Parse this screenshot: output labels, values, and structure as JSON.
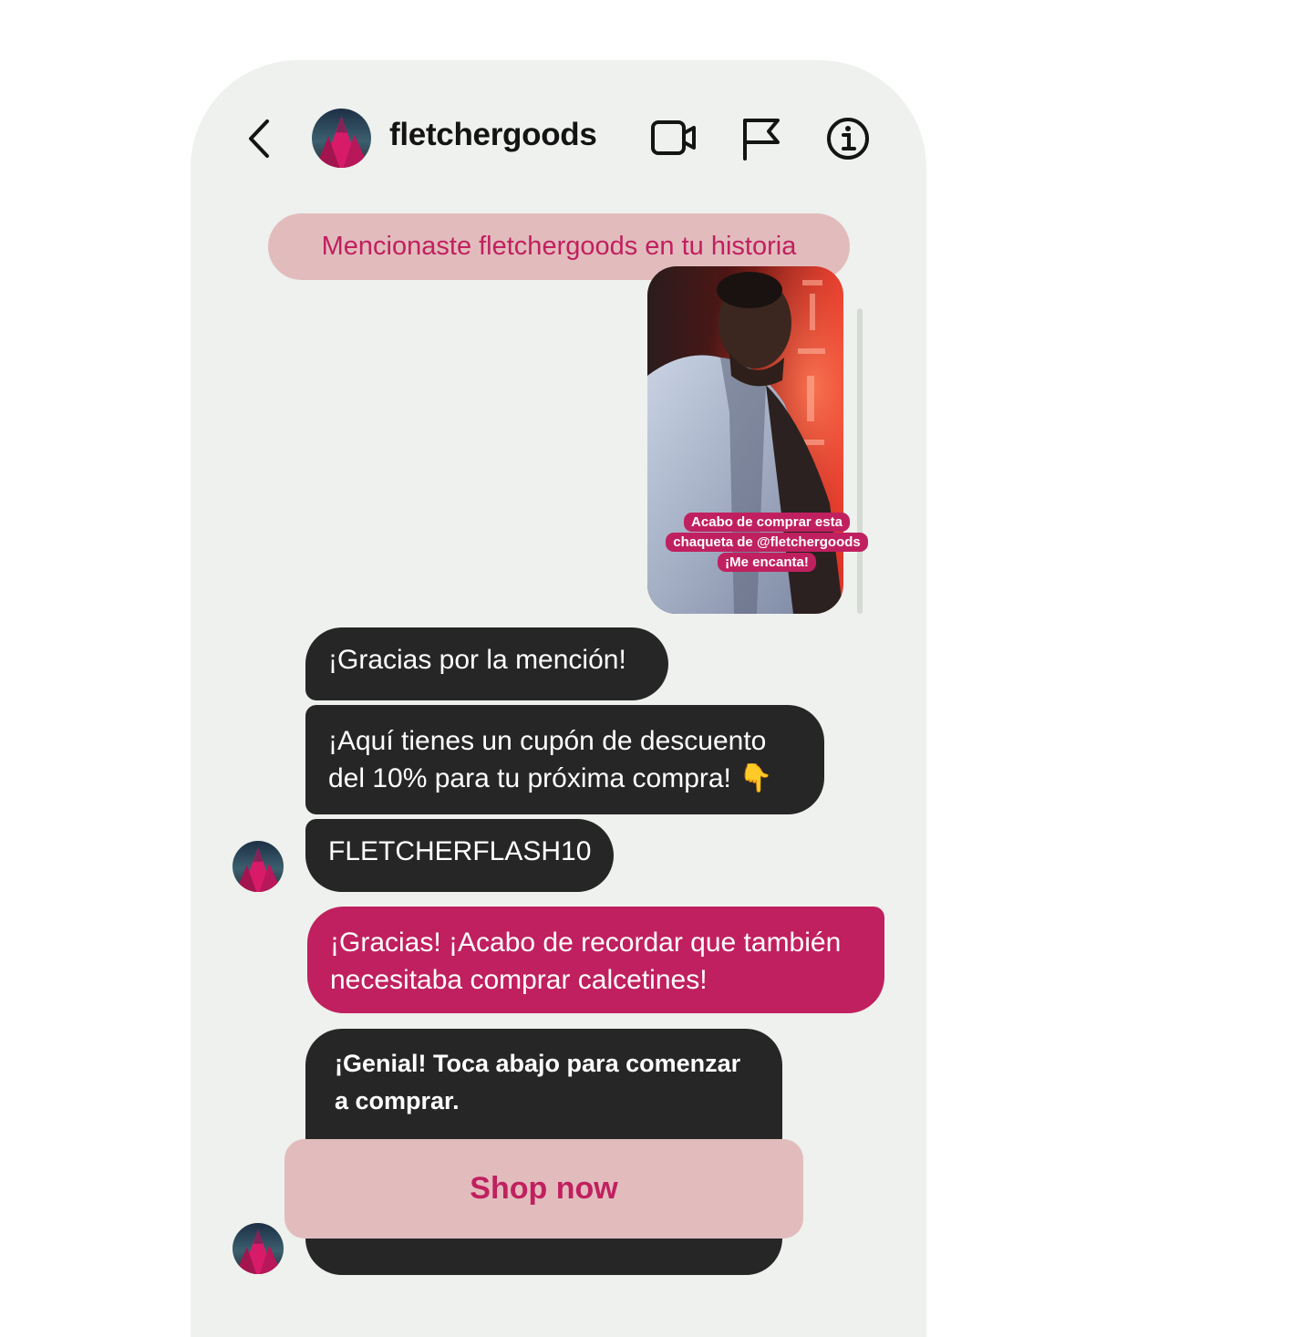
{
  "header": {
    "username": "fletchergoods",
    "icons": [
      "back-icon",
      "video-call-icon",
      "flag-icon",
      "info-icon"
    ]
  },
  "mention_banner": "Mencionaste fletchergoods en tu historia",
  "story": {
    "caption_lines": [
      "Acabo de comprar esta",
      "chaqueta de @fletchergoods",
      "¡Me encanta!"
    ]
  },
  "messages": [
    {
      "from": "business",
      "text": "¡Gracias por la mención!"
    },
    {
      "from": "business",
      "text": "¡Aquí tienes un cupón de descuento del 10% para tu próxima compra! 👇"
    },
    {
      "from": "business",
      "text": "FLETCHERFLASH10"
    },
    {
      "from": "user",
      "text": "¡Gracias! ¡Acabo de recordar que también necesitaba comprar calcetines!"
    },
    {
      "from": "business",
      "text": "¡Genial! Toca abajo para comenzar a comprar."
    }
  ],
  "cta": {
    "label": "Shop now"
  },
  "colors": {
    "background": "#eef1ed",
    "accent": "#c0205f",
    "accent_light": "#e2bcbd",
    "bubble_dark": "#262626"
  }
}
